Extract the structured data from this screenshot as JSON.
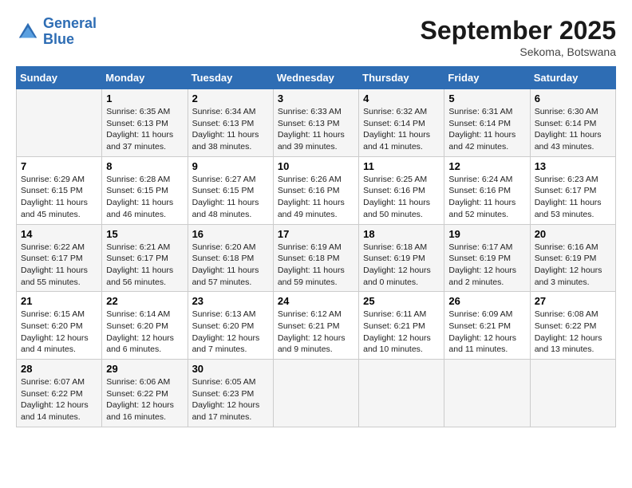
{
  "logo": {
    "line1": "General",
    "line2": "Blue"
  },
  "title": "September 2025",
  "location": "Sekoma, Botswana",
  "weekdays": [
    "Sunday",
    "Monday",
    "Tuesday",
    "Wednesday",
    "Thursday",
    "Friday",
    "Saturday"
  ],
  "weeks": [
    [
      {
        "day": "",
        "sunrise": "",
        "sunset": "",
        "daylight": ""
      },
      {
        "day": "1",
        "sunrise": "Sunrise: 6:35 AM",
        "sunset": "Sunset: 6:13 PM",
        "daylight": "Daylight: 11 hours and 37 minutes."
      },
      {
        "day": "2",
        "sunrise": "Sunrise: 6:34 AM",
        "sunset": "Sunset: 6:13 PM",
        "daylight": "Daylight: 11 hours and 38 minutes."
      },
      {
        "day": "3",
        "sunrise": "Sunrise: 6:33 AM",
        "sunset": "Sunset: 6:13 PM",
        "daylight": "Daylight: 11 hours and 39 minutes."
      },
      {
        "day": "4",
        "sunrise": "Sunrise: 6:32 AM",
        "sunset": "Sunset: 6:14 PM",
        "daylight": "Daylight: 11 hours and 41 minutes."
      },
      {
        "day": "5",
        "sunrise": "Sunrise: 6:31 AM",
        "sunset": "Sunset: 6:14 PM",
        "daylight": "Daylight: 11 hours and 42 minutes."
      },
      {
        "day": "6",
        "sunrise": "Sunrise: 6:30 AM",
        "sunset": "Sunset: 6:14 PM",
        "daylight": "Daylight: 11 hours and 43 minutes."
      }
    ],
    [
      {
        "day": "7",
        "sunrise": "Sunrise: 6:29 AM",
        "sunset": "Sunset: 6:15 PM",
        "daylight": "Daylight: 11 hours and 45 minutes."
      },
      {
        "day": "8",
        "sunrise": "Sunrise: 6:28 AM",
        "sunset": "Sunset: 6:15 PM",
        "daylight": "Daylight: 11 hours and 46 minutes."
      },
      {
        "day": "9",
        "sunrise": "Sunrise: 6:27 AM",
        "sunset": "Sunset: 6:15 PM",
        "daylight": "Daylight: 11 hours and 48 minutes."
      },
      {
        "day": "10",
        "sunrise": "Sunrise: 6:26 AM",
        "sunset": "Sunset: 6:16 PM",
        "daylight": "Daylight: 11 hours and 49 minutes."
      },
      {
        "day": "11",
        "sunrise": "Sunrise: 6:25 AM",
        "sunset": "Sunset: 6:16 PM",
        "daylight": "Daylight: 11 hours and 50 minutes."
      },
      {
        "day": "12",
        "sunrise": "Sunrise: 6:24 AM",
        "sunset": "Sunset: 6:16 PM",
        "daylight": "Daylight: 11 hours and 52 minutes."
      },
      {
        "day": "13",
        "sunrise": "Sunrise: 6:23 AM",
        "sunset": "Sunset: 6:17 PM",
        "daylight": "Daylight: 11 hours and 53 minutes."
      }
    ],
    [
      {
        "day": "14",
        "sunrise": "Sunrise: 6:22 AM",
        "sunset": "Sunset: 6:17 PM",
        "daylight": "Daylight: 11 hours and 55 minutes."
      },
      {
        "day": "15",
        "sunrise": "Sunrise: 6:21 AM",
        "sunset": "Sunset: 6:17 PM",
        "daylight": "Daylight: 11 hours and 56 minutes."
      },
      {
        "day": "16",
        "sunrise": "Sunrise: 6:20 AM",
        "sunset": "Sunset: 6:18 PM",
        "daylight": "Daylight: 11 hours and 57 minutes."
      },
      {
        "day": "17",
        "sunrise": "Sunrise: 6:19 AM",
        "sunset": "Sunset: 6:18 PM",
        "daylight": "Daylight: 11 hours and 59 minutes."
      },
      {
        "day": "18",
        "sunrise": "Sunrise: 6:18 AM",
        "sunset": "Sunset: 6:19 PM",
        "daylight": "Daylight: 12 hours and 0 minutes."
      },
      {
        "day": "19",
        "sunrise": "Sunrise: 6:17 AM",
        "sunset": "Sunset: 6:19 PM",
        "daylight": "Daylight: 12 hours and 2 minutes."
      },
      {
        "day": "20",
        "sunrise": "Sunrise: 6:16 AM",
        "sunset": "Sunset: 6:19 PM",
        "daylight": "Daylight: 12 hours and 3 minutes."
      }
    ],
    [
      {
        "day": "21",
        "sunrise": "Sunrise: 6:15 AM",
        "sunset": "Sunset: 6:20 PM",
        "daylight": "Daylight: 12 hours and 4 minutes."
      },
      {
        "day": "22",
        "sunrise": "Sunrise: 6:14 AM",
        "sunset": "Sunset: 6:20 PM",
        "daylight": "Daylight: 12 hours and 6 minutes."
      },
      {
        "day": "23",
        "sunrise": "Sunrise: 6:13 AM",
        "sunset": "Sunset: 6:20 PM",
        "daylight": "Daylight: 12 hours and 7 minutes."
      },
      {
        "day": "24",
        "sunrise": "Sunrise: 6:12 AM",
        "sunset": "Sunset: 6:21 PM",
        "daylight": "Daylight: 12 hours and 9 minutes."
      },
      {
        "day": "25",
        "sunrise": "Sunrise: 6:11 AM",
        "sunset": "Sunset: 6:21 PM",
        "daylight": "Daylight: 12 hours and 10 minutes."
      },
      {
        "day": "26",
        "sunrise": "Sunrise: 6:09 AM",
        "sunset": "Sunset: 6:21 PM",
        "daylight": "Daylight: 12 hours and 11 minutes."
      },
      {
        "day": "27",
        "sunrise": "Sunrise: 6:08 AM",
        "sunset": "Sunset: 6:22 PM",
        "daylight": "Daylight: 12 hours and 13 minutes."
      }
    ],
    [
      {
        "day": "28",
        "sunrise": "Sunrise: 6:07 AM",
        "sunset": "Sunset: 6:22 PM",
        "daylight": "Daylight: 12 hours and 14 minutes."
      },
      {
        "day": "29",
        "sunrise": "Sunrise: 6:06 AM",
        "sunset": "Sunset: 6:22 PM",
        "daylight": "Daylight: 12 hours and 16 minutes."
      },
      {
        "day": "30",
        "sunrise": "Sunrise: 6:05 AM",
        "sunset": "Sunset: 6:23 PM",
        "daylight": "Daylight: 12 hours and 17 minutes."
      },
      {
        "day": "",
        "sunrise": "",
        "sunset": "",
        "daylight": ""
      },
      {
        "day": "",
        "sunrise": "",
        "sunset": "",
        "daylight": ""
      },
      {
        "day": "",
        "sunrise": "",
        "sunset": "",
        "daylight": ""
      },
      {
        "day": "",
        "sunrise": "",
        "sunset": "",
        "daylight": ""
      }
    ]
  ]
}
